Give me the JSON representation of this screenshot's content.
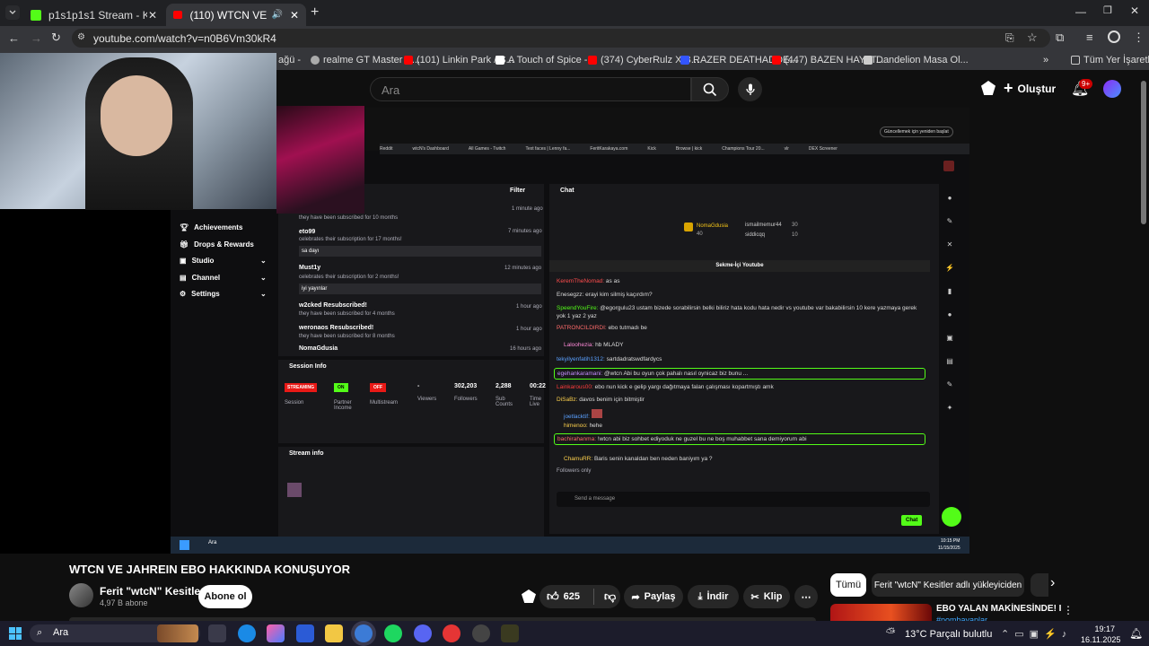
{
  "browser": {
    "tabs": [
      {
        "label": "p1s1p1s1 Stream - Kick Dashbo"
      },
      {
        "label": "(110) WTCN VE JAHREIN E"
      }
    ],
    "url": "youtube.com/watch?v=n0B6Vm30kR4",
    "bookmarks": [
      "ağü -",
      "realme GT Master E...",
      "(101) Linkin Park / S...",
      "A Touch of Spice -...",
      "(374) CyberRulz X B...",
      "RAZER DEATHADDE...",
      "(447) BAZEN HAYAT...",
      "Dandelion Masa Ol..."
    ],
    "all_bookmarks": "Tüm Yer İşaretleri"
  },
  "youtube": {
    "search_placeholder": "Ara",
    "create_label": "Oluştur",
    "notif_badge": "9+"
  },
  "stream": {
    "left_menu": [
      "Achievements",
      "Drops & Rewards",
      "Studio",
      "Channel",
      "Settings"
    ],
    "activity_header": "Filter",
    "activity": [
      {
        "name": "",
        "text": "they have been subscribed for 10 months",
        "time": "1 minute ago"
      },
      {
        "name": "eto99",
        "text": "celebrates their subscription for 17 months!",
        "time": "7 minutes ago",
        "msg": "sa dayı"
      },
      {
        "name": "Must1y",
        "text": "celebrates their subscription for 2 months!",
        "time": "12 minutes ago",
        "msg": "iyi yayınlar"
      },
      {
        "name": "w2cked Resubscribed!",
        "text": "they have been subscribed for 4 months",
        "time": "1 hour ago"
      },
      {
        "name": "weronaos Resubscribed!",
        "text": "they have been subscribed for 8 months",
        "time": "1 hour ago"
      },
      {
        "name": "NomaGdusia",
        "text": "",
        "time": "16 hours ago"
      }
    ],
    "session_info_title": "Session Info",
    "session": [
      {
        "badge": "STREAMING",
        "label": "Session"
      },
      {
        "badge": "ON",
        "label": "Partner Income"
      },
      {
        "badge": "OFF",
        "label": "Multistream"
      },
      {
        "badge": "-",
        "label": "Viewers"
      },
      {
        "badge": "302,203",
        "label": "Followers"
      },
      {
        "badge": "2,288",
        "label": "Sub Counts"
      },
      {
        "badge": "00:22",
        "label": "Time Live"
      }
    ],
    "stream_info_title": "Stream info",
    "chat_title": "Chat",
    "chat_top": {
      "user1": "NomaGdusia",
      "user1_count": "40",
      "user2": "ismailmemur44",
      "user2_count": "30",
      "user3": "siddicqq",
      "user3_count": "10"
    },
    "chat_banner": "Sekme-İçi Youtube",
    "chat_messages": [
      {
        "user": "KeremTheNomad:",
        "text": "as as"
      },
      {
        "user": "Enesegzz:",
        "text": "erayi kim silmiş kaçırdım?"
      },
      {
        "user": "SpeendYouFire:",
        "text": "@egorgulu23 ustam bizede sorabilirsin belki biliriz hata kodu hata nedir vs youtube var bakabilirsin 10 kere yazmaya gerek yok 1 yaz 2 yaz"
      },
      {
        "user": "PATRONCILDIRDI:",
        "text": "ebo tutmadı be"
      },
      {
        "user": "Laloohezia:",
        "text": "hb MLADY"
      },
      {
        "user": "tekyilyenfatih1312:",
        "text": "sartdadratswdfardycs"
      },
      {
        "user": "egehankaramani:",
        "text": "@wtcn Abi bu oyun çok pahalı nasıl oynicaz biz bunu ..."
      },
      {
        "user": "Lainkarous00:",
        "text": "ebo nun kick e gelip yargı dağıtmaya falan çalışması kopartmıştı amk"
      },
      {
        "user": "DiSaBz:",
        "text": "davos benim için bitmiştir"
      },
      {
        "user": "joetlacktif:",
        "text": ""
      },
      {
        "user": "himenoo:",
        "text": "hehe"
      },
      {
        "user": "bachirahanma:",
        "text": "!wtcn abi biz sohbet ediyoduk ne guzel bu ne boş muhabbet sana demiyorum abi"
      },
      {
        "user": "ChamuRR:",
        "text": "Baris senin kanaldan ben neden baniyım ya ?"
      }
    ],
    "chat_followers_only": "Followers only",
    "send_placeholder": "Send a message",
    "chat_button": "Chat",
    "inner_tray_time": "10:15 PM",
    "inner_tray_date": "11/15/2025",
    "inner_search": "Ara"
  },
  "video_info": {
    "title": "WTCN VE JAHREIN EBO HAKKINDA KONUŞUYOR",
    "channel": "Ferit \"wtcN\" Kesitler",
    "subscribers": "4,97 B abone",
    "subscribe_label": "Abone ol",
    "likes": "625",
    "share_label": "Paylaş",
    "download_label": "İndir",
    "clip_label": "Klip"
  },
  "sidebar_filters": [
    "Tümü",
    "Ferit \"wtcN\" Kesitler adlı yükleyiciden"
  ],
  "recommendation": {
    "title": "EBO YALAN MAKİNESİNDE! I",
    "subtitle": "#pombayaplar"
  },
  "taskbar": {
    "search": "Ara",
    "weather": "13°C  Parçalı bulutlu",
    "time": "19:17",
    "date": "16.11.2025"
  },
  "colors": {
    "kick_green": "#53fc18",
    "yt_red": "#ff0000",
    "streaming_red": "#e91916"
  }
}
